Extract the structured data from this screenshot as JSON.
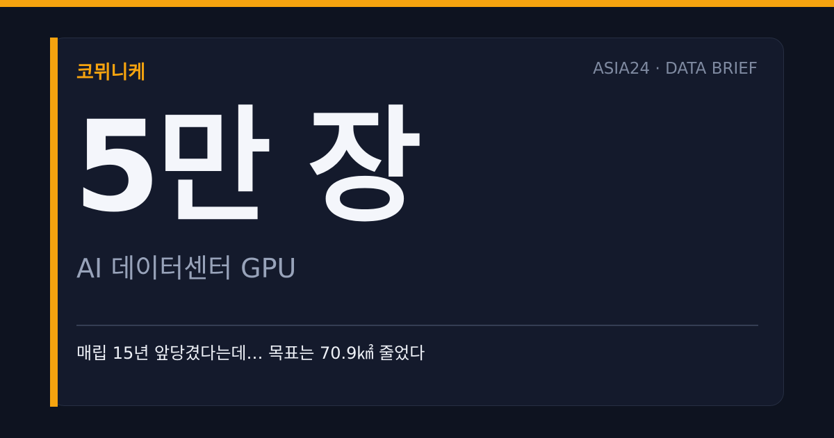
{
  "colors": {
    "accent": "#f5a30f",
    "background": "#0e1320",
    "card": "#141a2c",
    "headline": "#f4f6fb",
    "muted": "#98a3ba"
  },
  "brand": "코뮈니케",
  "source": "ASIA24 · DATA BRIEF",
  "headline": "5만 장",
  "subtitle": "AI 데이터센터 GPU",
  "caption": "매립 15년 앞당겼다는데… 목표는 70.9㎢ 줄었다"
}
